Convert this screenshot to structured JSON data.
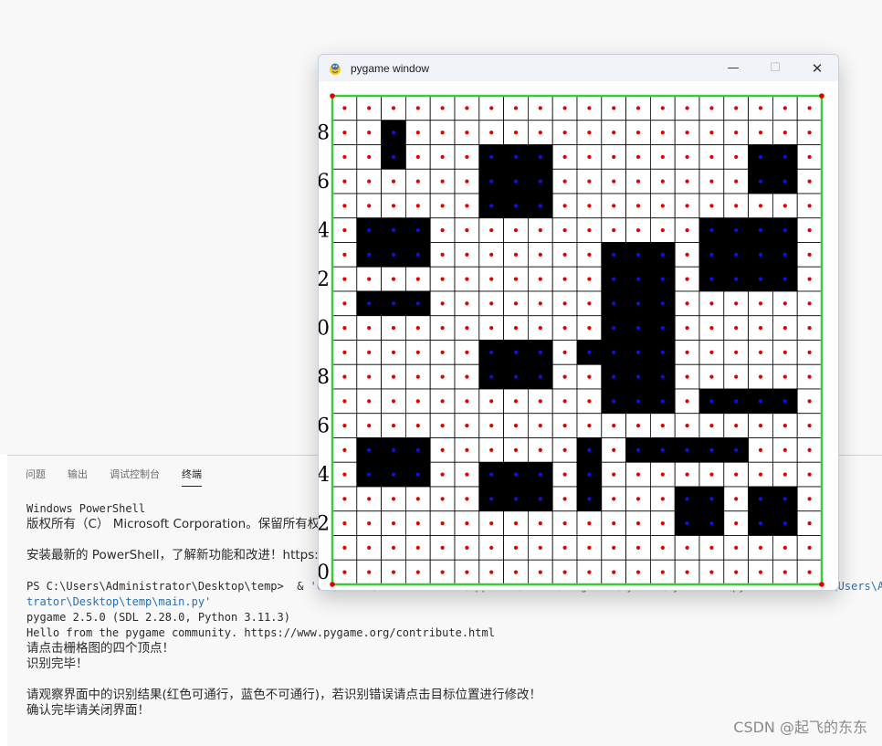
{
  "panel": {
    "tabs": [
      {
        "label": "问题",
        "active": false
      },
      {
        "label": "输出",
        "active": false
      },
      {
        "label": "调试控制台",
        "active": false
      },
      {
        "label": "终端",
        "active": true
      }
    ]
  },
  "terminal": {
    "lines": [
      {
        "text": "Windows PowerShell",
        "color": "normal"
      },
      {
        "text": "版权所有（C） Microsoft Corporation。保留所有权利。",
        "color": "normal"
      },
      {
        "text": "",
        "color": "normal"
      },
      {
        "text": "安装最新的 PowerShell，了解新功能和改进！https://aka.ms/PSWindows",
        "color": "normal"
      },
      {
        "text": "",
        "color": "normal"
      },
      {
        "text": "PS C:\\Users\\Administrator\\Desktop\\temp>  & 'C:\\Users\\Administrator\\AppData\\Local\\Programs\\Python\\Python311\\python.exe' 'c:\\Users\\Admin",
        "color": "mixed"
      },
      {
        "text": "trator\\Desktop\\temp\\main.py'",
        "color": "blue"
      },
      {
        "text": "pygame 2.5.0 (SDL 2.28.0, Python 3.11.3)",
        "color": "normal"
      },
      {
        "text": "Hello from the pygame community. https://www.pygame.org/contribute.html",
        "color": "normal"
      },
      {
        "text": "请点击栅格图的四个顶点！",
        "color": "normal"
      },
      {
        "text": "识别完毕！",
        "color": "normal"
      },
      {
        "text": "",
        "color": "normal"
      },
      {
        "text": "请观察界面中的识别结果(红色可通行，蓝色不可通行)，若识别错误请点击目标位置进行修改！",
        "color": "normal"
      },
      {
        "text": "确认完毕请关闭界面！",
        "color": "normal"
      }
    ]
  },
  "watermark": "CSDN @起飞的东东",
  "pygame_window": {
    "title": "pygame window",
    "minimize_glyph": "—",
    "maximize_glyph": "☐",
    "close_glyph": "✕",
    "icons": {
      "logo": "pygame-snake-logo-icon"
    }
  },
  "grid": {
    "cols": 20,
    "rows": 20,
    "colors": {
      "border": "#3cc93c",
      "passable_dot": "#e00000",
      "blocked_dot": "#1010e0",
      "obstacle_fill": "#000000",
      "line": "#000000"
    },
    "y_labels": [
      {
        "text": "8",
        "row": 1
      },
      {
        "text": "6",
        "row": 3
      },
      {
        "text": "4",
        "row": 5
      },
      {
        "text": "2",
        "row": 7
      },
      {
        "text": "0",
        "row": 9
      },
      {
        "text": "8",
        "row": 11
      },
      {
        "text": "6",
        "row": 13
      },
      {
        "text": "4",
        "row": 15
      },
      {
        "text": "2",
        "row": 17
      },
      {
        "text": "0",
        "row": 19
      }
    ],
    "obstacles": [
      [
        2,
        1
      ],
      [
        2,
        2
      ],
      [
        6,
        2
      ],
      [
        7,
        2
      ],
      [
        8,
        2
      ],
      [
        6,
        3
      ],
      [
        7,
        3
      ],
      [
        8,
        3
      ],
      [
        6,
        4
      ],
      [
        7,
        4
      ],
      [
        8,
        4
      ],
      [
        17,
        2
      ],
      [
        18,
        2
      ],
      [
        17,
        3
      ],
      [
        18,
        3
      ],
      [
        1,
        5
      ],
      [
        2,
        5
      ],
      [
        3,
        5
      ],
      [
        1,
        6
      ],
      [
        2,
        6
      ],
      [
        3,
        6
      ],
      [
        1,
        8
      ],
      [
        2,
        8
      ],
      [
        3,
        8
      ],
      [
        15,
        5
      ],
      [
        16,
        5
      ],
      [
        17,
        5
      ],
      [
        18,
        5
      ],
      [
        15,
        6
      ],
      [
        16,
        6
      ],
      [
        17,
        6
      ],
      [
        18,
        6
      ],
      [
        15,
        7
      ],
      [
        16,
        7
      ],
      [
        17,
        7
      ],
      [
        18,
        7
      ],
      [
        11,
        6
      ],
      [
        12,
        6
      ],
      [
        13,
        6
      ],
      [
        11,
        7
      ],
      [
        12,
        7
      ],
      [
        13,
        7
      ],
      [
        11,
        8
      ],
      [
        12,
        8
      ],
      [
        13,
        8
      ],
      [
        11,
        9
      ],
      [
        12,
        9
      ],
      [
        13,
        9
      ],
      [
        10,
        10
      ],
      [
        11,
        10
      ],
      [
        12,
        10
      ],
      [
        13,
        10
      ],
      [
        11,
        11
      ],
      [
        12,
        11
      ],
      [
        13,
        11
      ],
      [
        11,
        12
      ],
      [
        12,
        12
      ],
      [
        13,
        12
      ],
      [
        6,
        10
      ],
      [
        7,
        10
      ],
      [
        8,
        10
      ],
      [
        6,
        11
      ],
      [
        7,
        11
      ],
      [
        8,
        11
      ],
      [
        15,
        12
      ],
      [
        16,
        12
      ],
      [
        17,
        12
      ],
      [
        18,
        12
      ],
      [
        1,
        14
      ],
      [
        2,
        14
      ],
      [
        3,
        14
      ],
      [
        1,
        15
      ],
      [
        2,
        15
      ],
      [
        3,
        15
      ],
      [
        10,
        14
      ],
      [
        10,
        15
      ],
      [
        10,
        16
      ],
      [
        12,
        14
      ],
      [
        13,
        14
      ],
      [
        14,
        14
      ],
      [
        15,
        14
      ],
      [
        16,
        14
      ],
      [
        6,
        15
      ],
      [
        7,
        15
      ],
      [
        8,
        15
      ],
      [
        6,
        16
      ],
      [
        7,
        16
      ],
      [
        8,
        16
      ],
      [
        14,
        16
      ],
      [
        15,
        16
      ],
      [
        14,
        17
      ],
      [
        15,
        17
      ],
      [
        17,
        16
      ],
      [
        18,
        16
      ],
      [
        17,
        17
      ],
      [
        18,
        17
      ]
    ]
  }
}
